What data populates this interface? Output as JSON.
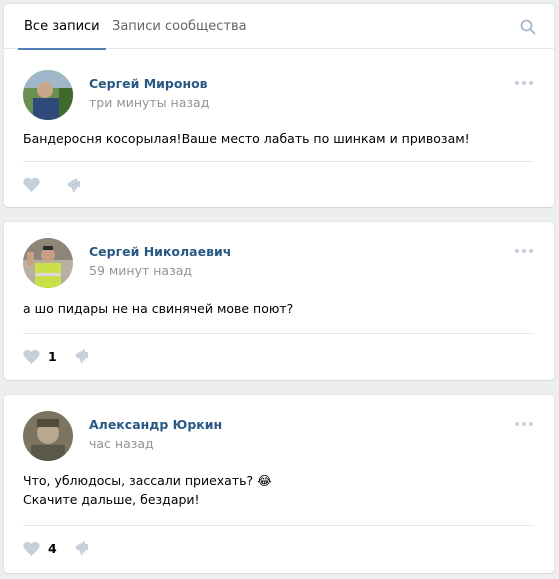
{
  "tabs": [
    {
      "label": "Все записи",
      "active": true
    },
    {
      "label": "Записи сообщества",
      "active": false
    }
  ],
  "colors": {
    "accent": "#5181b8",
    "author": "#2a5885",
    "time": "#939393",
    "icon": "#c5d0db"
  },
  "posts": [
    {
      "author": "Сергей Миронов",
      "time": "три минуты назад",
      "text_lines": [
        "Бандеросня косорылая!Ваше место лабать по шинкам и привозам!"
      ],
      "likes": ""
    },
    {
      "author": "Сергей Николаевич",
      "time": "59 минут назад",
      "text_lines": [
        "а шо пидары не на свинячей мове поют?"
      ],
      "likes": "1"
    },
    {
      "author": "Александр Юркин",
      "time": "час назад",
      "text_lines": [
        "Что, ублюдосы, зассали приехать? 😂",
        "Скачите дальше, бездари!"
      ],
      "likes": "4"
    }
  ]
}
